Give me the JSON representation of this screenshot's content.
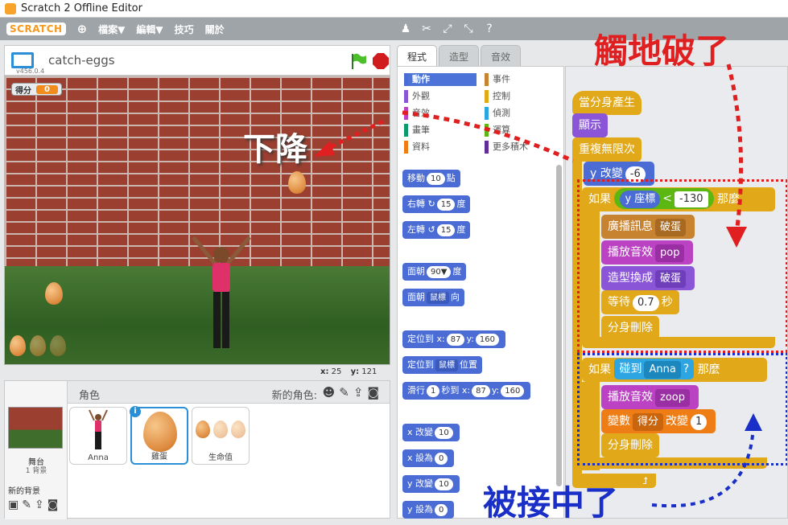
{
  "window": {
    "title": "Scratch 2 Offline Editor"
  },
  "menu": {
    "logo": "SCRATCH",
    "file": "檔案▼",
    "edit": "編輯▼",
    "tips": "技巧",
    "about": "關於"
  },
  "project": {
    "name": "catch-eggs",
    "version": "v456.0.4"
  },
  "stage": {
    "monitor_label": "得分",
    "monitor_value": "0",
    "x_label": "x:",
    "x_value": "25",
    "y_label": "y:",
    "y_value": "121"
  },
  "sprites": {
    "header_label": "角色",
    "new_sprite_label": "新的角色:",
    "stage_label": "舞台",
    "stage_bg_count": "1 背景",
    "new_backdrop_label": "新的背景",
    "items": [
      {
        "name": "Anna"
      },
      {
        "name": "雞蛋"
      },
      {
        "name": "生命值"
      }
    ]
  },
  "tabs": [
    "程式",
    "造型",
    "音效"
  ],
  "categories": [
    {
      "label": "動作",
      "color": "#4a6cd4"
    },
    {
      "label": "事件",
      "color": "#c88330"
    },
    {
      "label": "外觀",
      "color": "#8a55d7"
    },
    {
      "label": "控制",
      "color": "#e1a91a"
    },
    {
      "label": "音效",
      "color": "#bb42c3"
    },
    {
      "label": "偵測",
      "color": "#2ca5e2"
    },
    {
      "label": "畫筆",
      "color": "#0e9a6c"
    },
    {
      "label": "運算",
      "color": "#5cb712"
    },
    {
      "label": "資料",
      "color": "#ee7d16"
    },
    {
      "label": "更多積木",
      "color": "#632d99"
    }
  ],
  "palette_blocks": {
    "move": {
      "a": "移動",
      "v": "10",
      "b": "點"
    },
    "turn_right": {
      "a": "右轉",
      "v": "15",
      "b": "度"
    },
    "turn_left": {
      "a": "左轉",
      "v": "15",
      "b": "度"
    },
    "point_dir": {
      "a": "面朝",
      "v": "90▼",
      "b": "度"
    },
    "point_towards": {
      "a": "面朝",
      "v": "鼠標",
      "b": "向"
    },
    "goto_xy": {
      "a": "定位到 x:",
      "x": "87",
      "m": "y:",
      "y": "160"
    },
    "goto": {
      "a": "定位到",
      "v": "鼠標",
      "b": "位置"
    },
    "glide": {
      "a": "滑行",
      "s": "1",
      "m": "秒到 x:",
      "x": "87",
      "m2": "y:",
      "y": "160"
    },
    "change_x": {
      "a": "x 改變",
      "v": "10"
    },
    "set_x": {
      "a": "x 設為",
      "v": "0"
    },
    "change_y": {
      "a": "y 改變",
      "v": "10"
    },
    "set_y": {
      "a": "y 設為",
      "v": "0"
    }
  },
  "script": {
    "hat": "當分身產生",
    "show": "顯示",
    "forever": "重複無限次",
    "change_y": {
      "a": "y 改變",
      "v": "-6"
    },
    "if1": {
      "a": "如果",
      "rep": "y 座標",
      "op": "<",
      "v": "-130",
      "b": "那麼"
    },
    "broadcast": {
      "a": "廣播訊息",
      "v": "破蛋"
    },
    "play1": {
      "a": "播放音效",
      "v": "pop"
    },
    "costume": {
      "a": "造型換成",
      "v": "破蛋"
    },
    "wait": {
      "a": "等待",
      "v": "0.7",
      "b": "秒"
    },
    "delete1": "分身刪除",
    "if2": {
      "a": "如果",
      "sense": "碰到",
      "v": "Anna",
      "q": "?",
      "b": "那麼"
    },
    "play2": {
      "a": "播放音效",
      "v": "zoop"
    },
    "var": {
      "a": "變數",
      "v": "得分",
      "b": "改變",
      "n": "1"
    },
    "delete2": "分身刪除"
  },
  "annotations": {
    "falling": "下降",
    "hit_ground": "觸地破了",
    "caught": "被接中了",
    "red": "#e02020",
    "blue": "#1a2fc8"
  }
}
